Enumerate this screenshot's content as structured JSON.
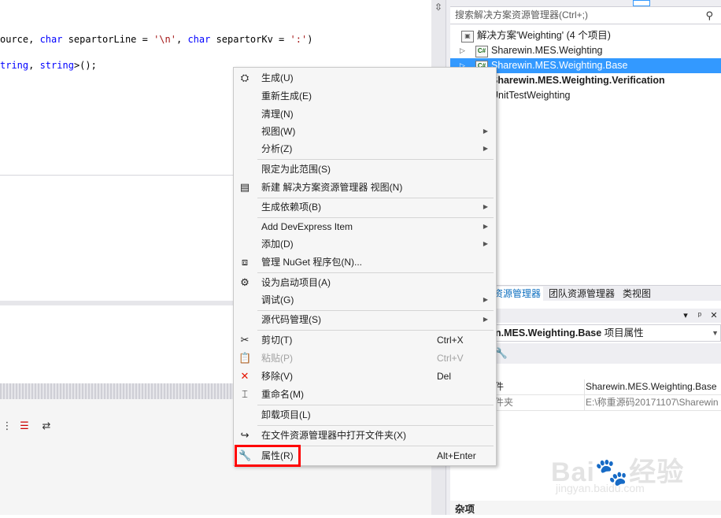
{
  "colors": {
    "selection": "#3399ff",
    "highlight_box": "#ff0000",
    "keyword": "#0000ff",
    "string": "#a31515"
  },
  "editor": {
    "line1": {
      "p1": "ource, ",
      "kw1": "char",
      "p2": " separtorLine = ",
      "s1": "'\\n'",
      "p3": ", ",
      "kw2": "char",
      "p4": " separtorKv = ",
      "s2": "':'",
      "p5": ")"
    },
    "line2": {
      "kw1": "tring",
      "p1": ", ",
      "kw2": "string",
      "p2": ">();"
    }
  },
  "solution_explorer": {
    "search_placeholder": "搜索解决方案资源管理器(Ctrl+;)",
    "search_icon": "search-icon",
    "tree": {
      "solution": "解决方案'Weighting' (4 个项目)",
      "items": [
        {
          "label": "Sharewin.MES.Weighting",
          "icon": "C#"
        },
        {
          "label": "Sharewin.MES.Weighting.Base",
          "icon": "C#"
        },
        {
          "label": "Sharewin.MES.Weighting.Verification"
        },
        {
          "label": "UnitTestWeighting"
        }
      ]
    },
    "tabs": [
      "资源管理器",
      "团队资源管理器",
      "类视图"
    ]
  },
  "properties": {
    "header_buttons": [
      "▾",
      "ᵖ",
      "✕"
    ],
    "title_bold": "n.MES.Weighting.Base",
    "title_suffix": " 项目属性",
    "rows": [
      {
        "key": "件",
        "value": "Sharewin.MES.Weighting.Base"
      },
      {
        "key": "件夹",
        "value": "E:\\称重源码20171107\\Sharewin"
      }
    ],
    "category": "杂项"
  },
  "context_menu": {
    "items": [
      {
        "label": "生成(U)",
        "icon": "build-icon"
      },
      {
        "label": "重新生成(E)"
      },
      {
        "label": "清理(N)"
      },
      {
        "label": "视图(W)",
        "submenu": true
      },
      {
        "label": "分析(Z)",
        "submenu": true
      },
      {
        "label": "限定为此范围(S)"
      },
      {
        "label": "新建 解决方案资源管理器 视图(N)",
        "icon": "new-view-icon"
      },
      {
        "label": "生成依赖项(B)",
        "submenu": true
      },
      {
        "label": "Add DevExpress Item",
        "submenu": true
      },
      {
        "label": "添加(D)",
        "submenu": true
      },
      {
        "label": "管理 NuGet 程序包(N)...",
        "icon": "nuget-icon"
      },
      {
        "label": "设为启动项目(A)",
        "icon": "gear-icon"
      },
      {
        "label": "调试(G)",
        "submenu": true
      },
      {
        "label": "源代码管理(S)",
        "submenu": true
      },
      {
        "label": "剪切(T)",
        "shortcut": "Ctrl+X",
        "icon": "cut-icon"
      },
      {
        "label": "粘贴(P)",
        "shortcut": "Ctrl+V",
        "icon": "paste-icon",
        "disabled": true
      },
      {
        "label": "移除(V)",
        "shortcut": "Del",
        "icon": "remove-icon"
      },
      {
        "label": "重命名(M)",
        "icon": "rename-icon"
      },
      {
        "label": "卸载项目(L)"
      },
      {
        "label": "在文件资源管理器中打开文件夹(X)",
        "icon": "open-folder-icon"
      },
      {
        "label": "属性(R)",
        "shortcut": "Alt+Enter",
        "icon": "wrench-icon"
      }
    ]
  },
  "watermark": {
    "brand": "Bai🐾经验",
    "url": "jingyan.baidu.com"
  }
}
